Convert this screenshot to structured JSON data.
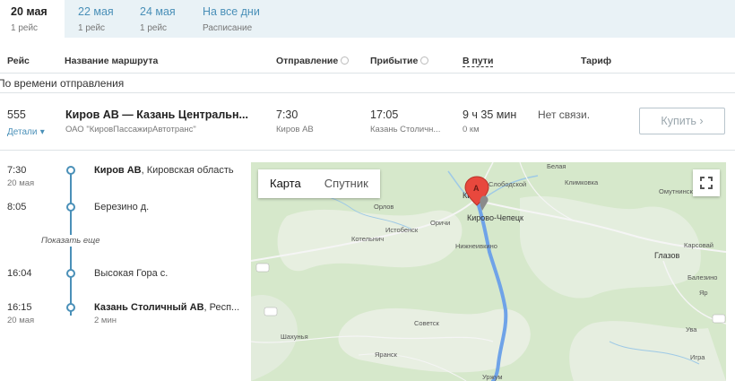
{
  "date_tabs": [
    {
      "date": "20 мая",
      "sub": "1 рейс",
      "active": true
    },
    {
      "date": "22 мая",
      "sub": "1 рейс",
      "active": false
    },
    {
      "date": "24 мая",
      "sub": "1 рейс",
      "active": false
    },
    {
      "date": "На все дни",
      "sub": "Расписание",
      "active": false
    }
  ],
  "columns": {
    "trip": "Рейс",
    "route_name": "Название маршрута",
    "departure": "Отправление",
    "arrival": "Прибытие",
    "on_way": "В пути",
    "fare": "Тариф"
  },
  "sort_label": "По времени отправления",
  "trip": {
    "number": "555",
    "details": "Детали",
    "route": "Киров АВ — Казань Центральн...",
    "carrier": "ОАО \"КировПассажирАвтотранс\"",
    "dep_time": "7:30",
    "dep_station": "Киров АВ",
    "arr_time": "17:05",
    "arr_station": "Казань Столичн...",
    "duration": "9 ч 35 мин",
    "distance": "0 км",
    "fare": "Нет связи.",
    "buy": "Купить ›"
  },
  "stops": [
    {
      "time": "7:30",
      "date": "20 мая",
      "name": "Киров АВ",
      "region": ", Кировская область",
      "extra": ""
    },
    {
      "time": "8:05",
      "date": "",
      "name": "Березино д.",
      "region": "",
      "extra": ""
    },
    {
      "time": "16:04",
      "date": "",
      "name": "Высокая Гора с.",
      "region": "",
      "extra": ""
    },
    {
      "time": "16:15",
      "date": "20 мая",
      "name": "Казань Столичный АВ",
      "region": ", Респ...",
      "extra": "2 мин"
    }
  ],
  "show_more": "Показать еще",
  "map": {
    "type_map": "Карта",
    "type_satellite": "Спутник",
    "marker": "A",
    "towns": [
      "Белая",
      "Слободской",
      "Климковка",
      "Омутнинск",
      "Ки",
      "Кирово-Чепецк",
      "Орлов",
      "Оричи",
      "Котельнич",
      "Истобенск",
      "Нижнеивкино",
      "Глазов",
      "Карсовай",
      "Балезино",
      "Яр",
      "Ува",
      "Шахунья",
      "Советск",
      "Яранск",
      "Уржум",
      "Игра"
    ],
    "route_color": "#6fa3e8"
  }
}
